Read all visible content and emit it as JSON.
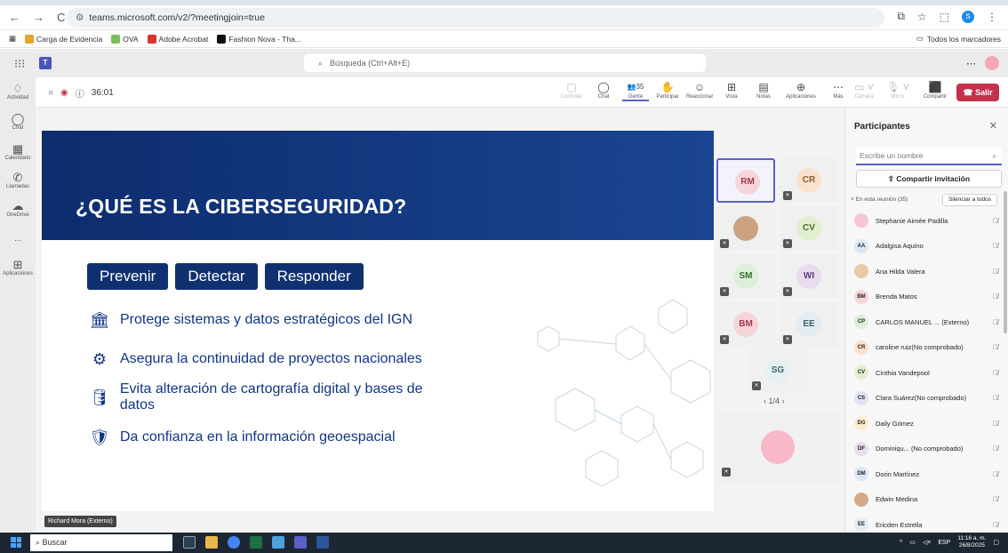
{
  "browser": {
    "nav": [
      "←",
      "→",
      "C"
    ],
    "url": "teams.microsoft.com/v2/?meetingjoin=true",
    "bookmarks": [
      "Carga de Evidencia",
      "OVA",
      "Adobe Acrobat",
      "Fashion Nova - Tha..."
    ],
    "all_bookmarks": "Todos los marcadores",
    "profile_initial": "S"
  },
  "teams": {
    "search_placeholder": "Búsqueda (Ctrl+Alt+E)",
    "rail": [
      "Actividad",
      "Chat",
      "Calendario",
      "Llamadas",
      "OneDrive",
      "...",
      "Aplicaciones"
    ],
    "timer": "36:01",
    "tools": [
      {
        "icon": "▢",
        "label": "Controlar",
        "disabled": true
      },
      {
        "icon": "◯",
        "label": "Chat"
      },
      {
        "icon": "35",
        "label": "Gente",
        "active": true
      },
      {
        "icon": "✋",
        "label": "Participar"
      },
      {
        "icon": "☺",
        "label": "Reaccionar"
      },
      {
        "icon": "⊞",
        "label": "Vista"
      },
      {
        "icon": "▤",
        "label": "Notas"
      },
      {
        "icon": "⊕",
        "label": "Aplicaciones"
      },
      {
        "icon": "⋯",
        "label": "Más"
      }
    ],
    "camera_label": "Cámara",
    "mic_label": "Micro",
    "share_label": "Compartir",
    "leave_label": "Salir"
  },
  "slide": {
    "title": "¿QUÉ ES LA CIBERSEGURIDAD?",
    "pills": [
      "Prevenir",
      "Detectar",
      "Responder"
    ],
    "bullets": [
      "Protege sistemas y datos estratégicos del IGN",
      "Asegura la continuidad de proyectos nacionales",
      "Evita alteración de cartografía digital y bases de datos",
      "Da confianza en la información geoespacial"
    ]
  },
  "gallery": {
    "tiles": [
      "RM",
      "CR",
      "",
      "CV",
      "SM",
      "WI",
      "BM",
      "EE",
      "SG"
    ],
    "pager": "1/4"
  },
  "presenter_tag": "Richard Mora (Externo)",
  "participants": {
    "title": "Participantes",
    "search_placeholder": "Escribe un nombre",
    "invite": "Compartir invitación",
    "in_meeting": "En esta reunión (35)",
    "mute_all": "Silenciar a todos",
    "people": [
      {
        "initials": "",
        "name": "Stephanie Aimée Padilla",
        "color": "#f7c6d3"
      },
      {
        "initials": "AA",
        "name": "Adalgisa Aquino",
        "color": "#dbe8f5"
      },
      {
        "initials": "",
        "name": "Ana Hilda Valera",
        "color": "#e8c9a8"
      },
      {
        "initials": "BM",
        "name": "Brenda Matos",
        "color": "#f6d5d9"
      },
      {
        "initials": "CP",
        "name": "CARLOS MANUEL ... (Externo)",
        "color": "#dcefd8"
      },
      {
        "initials": "CR",
        "name": "caroline ruiz(No comprobado)",
        "color": "#f9e1cc"
      },
      {
        "initials": "CV",
        "name": "Cinthia Vandepool",
        "color": "#e2efcf"
      },
      {
        "initials": "CS",
        "name": "Clara Suárez(No comprobado)",
        "color": "#dfe3f3"
      },
      {
        "initials": "DG",
        "name": "Daily Gómez",
        "color": "#fbeccc"
      },
      {
        "initials": "DF",
        "name": "Dominiqu... (No comprobado)",
        "color": "#e9dcef"
      },
      {
        "initials": "DM",
        "name": "Dorin Martínez",
        "color": "#dde6f6"
      },
      {
        "initials": "",
        "name": "Edwin Medina",
        "color": "#d6a985"
      },
      {
        "initials": "EE",
        "name": "Ericden Estrella",
        "color": "#e2ecf2"
      }
    ]
  },
  "taskbar": {
    "search": "Buscar",
    "lang": "ESP",
    "time": "11:16 a. m.",
    "date": "26/8/2025"
  }
}
